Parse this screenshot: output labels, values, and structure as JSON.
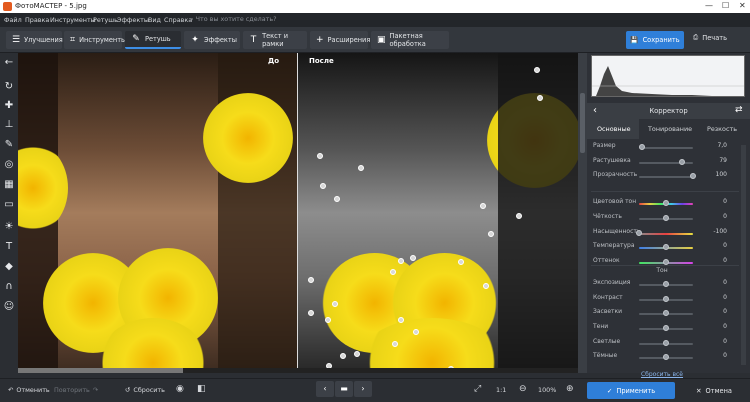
{
  "window": {
    "title": "ФотоМАСТЕР - 5.jpg"
  },
  "menu": {
    "items": [
      "Файл",
      "Правка",
      "Инструменты",
      "Ретушь",
      "Эффекты",
      "Вид",
      "Справка"
    ],
    "search_placeholder": "Что вы хотите сделать?"
  },
  "toolbar": {
    "tabs": [
      "Улучшения",
      "Инструменты",
      "Ретушь",
      "Эффекты",
      "Текст и рамки",
      "Расширения",
      "Пакетная обработка"
    ],
    "active_tab": "Ретушь",
    "save_label": "Сохранить",
    "print_label": "Печать"
  },
  "canvas": {
    "before_label": "До",
    "after_label": "После"
  },
  "panel": {
    "title": "Корректор",
    "tabs": [
      "Основные",
      "Тонирование",
      "Резкость"
    ],
    "active_tab": "Основные",
    "brush_rows": [
      {
        "name": "Размер",
        "value": "7,0",
        "pos": 0.05
      },
      {
        "name": "Растушевка",
        "value": "79",
        "pos": 0.79
      },
      {
        "name": "Прозрачность",
        "value": "100",
        "pos": 1.0
      }
    ],
    "color_rows": [
      {
        "name": "Цветовой тон",
        "value": "0",
        "pos": 0.5
      },
      {
        "name": "Чёткость",
        "value": "0",
        "pos": 0.5
      },
      {
        "name": "Насыщенность",
        "value": "-100",
        "pos": 0.0
      },
      {
        "name": "Температура",
        "value": "0",
        "pos": 0.5
      },
      {
        "name": "Оттенок",
        "value": "0",
        "pos": 0.5
      }
    ],
    "section_tone": "Тон",
    "tone_rows": [
      {
        "name": "Экспозиция",
        "value": "0",
        "pos": 0.5
      },
      {
        "name": "Контраст",
        "value": "0",
        "pos": 0.5
      },
      {
        "name": "Засветки",
        "value": "0",
        "pos": 0.5
      },
      {
        "name": "Тени",
        "value": "0",
        "pos": 0.5
      },
      {
        "name": "Светлые",
        "value": "0",
        "pos": 0.5
      },
      {
        "name": "Тёмные",
        "value": "0",
        "pos": 0.5
      }
    ],
    "reset_all": "Сбросить всё"
  },
  "bottom": {
    "undo": "Отменить",
    "redo": "Повторить",
    "reset": "Сбросить",
    "ratio": "1:1",
    "zoom": "100%",
    "apply": "Применить",
    "cancel": "Отмена"
  },
  "colors": {
    "accent": "#2f7fd9",
    "panel": "#2e3137",
    "active_tab_border": "#3d8ee6"
  }
}
